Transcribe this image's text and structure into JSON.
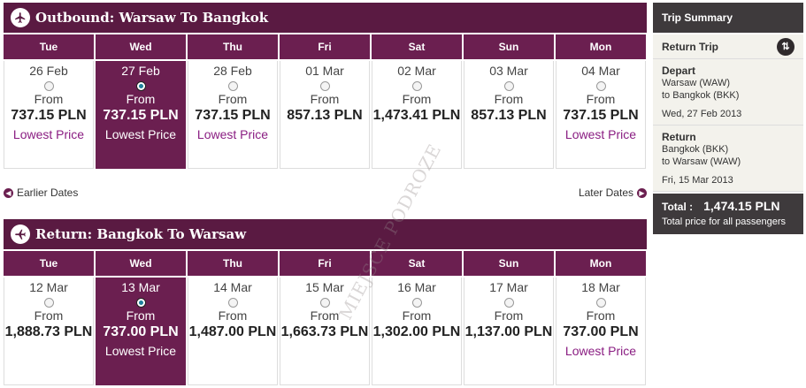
{
  "outbound": {
    "title": "Outbound: Warsaw To Bangkok",
    "days": [
      {
        "day": "Tue",
        "date": "26 Feb",
        "from": "From",
        "price": "737.15 PLN",
        "note": "Lowest Price",
        "selected": false
      },
      {
        "day": "Wed",
        "date": "27 Feb",
        "from": "From",
        "price": "737.15 PLN",
        "note": "Lowest Price",
        "selected": true
      },
      {
        "day": "Thu",
        "date": "28 Feb",
        "from": "From",
        "price": "737.15 PLN",
        "note": "Lowest Price",
        "selected": false
      },
      {
        "day": "Fri",
        "date": "01 Mar",
        "from": "From",
        "price": "857.13 PLN",
        "note": "",
        "selected": false
      },
      {
        "day": "Sat",
        "date": "02 Mar",
        "from": "From",
        "price": "1,473.41 PLN",
        "note": "",
        "selected": false
      },
      {
        "day": "Sun",
        "date": "03 Mar",
        "from": "From",
        "price": "857.13 PLN",
        "note": "",
        "selected": false
      },
      {
        "day": "Mon",
        "date": "04 Mar",
        "from": "From",
        "price": "737.15 PLN",
        "note": "Lowest Price",
        "selected": false
      }
    ]
  },
  "nav": {
    "earlier": "Earlier Dates",
    "later": "Later Dates"
  },
  "return": {
    "title": "Return: Bangkok To Warsaw",
    "days": [
      {
        "day": "Tue",
        "date": "12 Mar",
        "from": "From",
        "price": "1,888.73 PLN",
        "note": "",
        "selected": false
      },
      {
        "day": "Wed",
        "date": "13 Mar",
        "from": "From",
        "price": "737.00 PLN",
        "note": "Lowest Price",
        "selected": true
      },
      {
        "day": "Thu",
        "date": "14 Mar",
        "from": "From",
        "price": "1,487.00 PLN",
        "note": "",
        "selected": false
      },
      {
        "day": "Fri",
        "date": "15 Mar",
        "from": "From",
        "price": "1,663.73 PLN",
        "note": "",
        "selected": false
      },
      {
        "day": "Sat",
        "date": "16 Mar",
        "from": "From",
        "price": "1,302.00 PLN",
        "note": "",
        "selected": false
      },
      {
        "day": "Sun",
        "date": "17 Mar",
        "from": "From",
        "price": "1,137.00 PLN",
        "note": "",
        "selected": false
      },
      {
        "day": "Mon",
        "date": "18 Mar",
        "from": "From",
        "price": "737.00 PLN",
        "note": "Lowest Price",
        "selected": false
      }
    ]
  },
  "summary": {
    "title": "Trip Summary",
    "trip_type": "Return Trip",
    "depart": {
      "label": "Depart",
      "from": "Warsaw (WAW)",
      "to": "to Bangkok (BKK)",
      "date": "Wed, 27 Feb 2013"
    },
    "return": {
      "label": "Return",
      "from": "Bangkok (BKK)",
      "to": "to Warsaw (WAW)",
      "date": "Fri, 15 Mar 2013"
    },
    "total_label": "Total :",
    "total_amount": "1,474.15  PLN",
    "total_note": "Total price for all passengers"
  },
  "watermark": "MIEJSCE PODROZE",
  "colors": {
    "plum": "#6b1f50",
    "header": "#5a1a42",
    "summary_dark": "#3e3a3c",
    "lowest": "#8a1d82"
  }
}
